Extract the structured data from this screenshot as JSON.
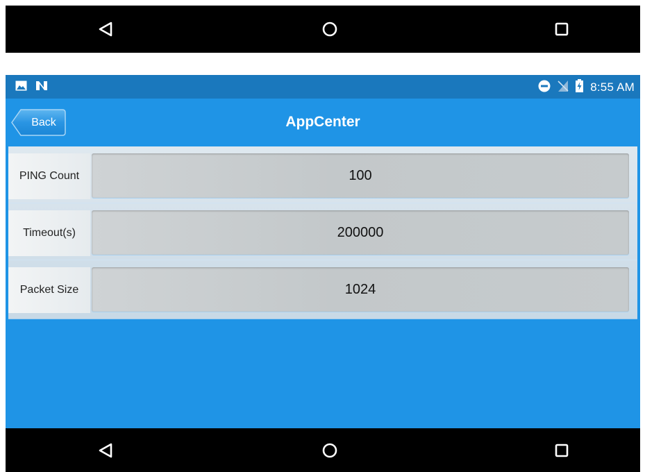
{
  "system_nav": {
    "top": {
      "back": "back-icon",
      "home": "home-icon",
      "recents": "recents-icon"
    },
    "bottom": {
      "back": "back-icon",
      "home": "home-icon",
      "recents": "recents-icon"
    }
  },
  "status_bar": {
    "time": "8:55 AM",
    "left_icons": [
      "image-notification-icon",
      "n-notification-icon"
    ],
    "right_icons": [
      "do-not-disturb-icon",
      "no-sim-icon",
      "battery-charging-icon"
    ]
  },
  "header": {
    "back_label": "Back",
    "title": "AppCenter"
  },
  "form": {
    "rows": [
      {
        "label": "PING Count",
        "value": "100"
      },
      {
        "label": "Timeout(s)",
        "value": "200000"
      },
      {
        "label": "Packet Size",
        "value": "1024"
      }
    ]
  },
  "colors": {
    "status_bar": "#1a78bd",
    "app_background": "#1f94e6",
    "nav_bar": "#000000"
  }
}
